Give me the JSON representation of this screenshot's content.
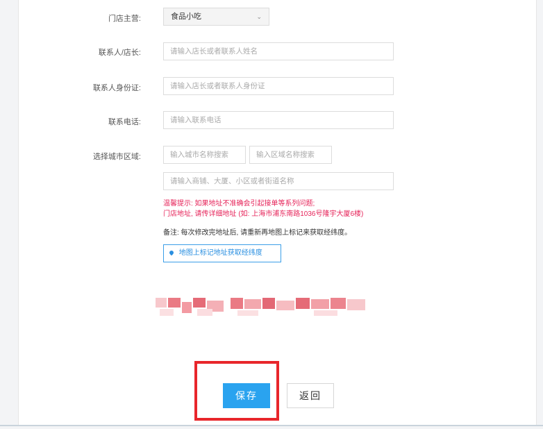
{
  "form": {
    "main_business_label": "门店主营:",
    "main_business_value": "食品小吃",
    "contact_label": "联系人/店长:",
    "contact_placeholder": "请输入店长或者联系人姓名",
    "idcard_label": "联系人身份证:",
    "idcard_placeholder": "请输入店长或者联系人身份证",
    "phone_label": "联系电话:",
    "phone_placeholder": "请输入联系电话",
    "city_label": "选择城市区域:",
    "city_placeholder": "输入城市名称搜索",
    "area_placeholder": "输入区域名称搜索",
    "address_placeholder": "请输入商铺、大厦、小区或者街道名称",
    "warning_line1": "温馨提示: 如果地址不准确会引起接单等系列问题;",
    "warning_line2": "门店地址, 请传详细地址 (如: 上海市浦东南路1036号隆宇大厦6楼)",
    "note": "备注: 每次修改完地址后, 请重新再地图上标记来获取经纬度。",
    "map_button": "地图上标记地址获取经纬度"
  },
  "actions": {
    "save": "保存",
    "back": "返回"
  },
  "colors": {
    "primary": "#2aa3ef",
    "warning": "#e6245a",
    "highlight": "#e8262b"
  }
}
